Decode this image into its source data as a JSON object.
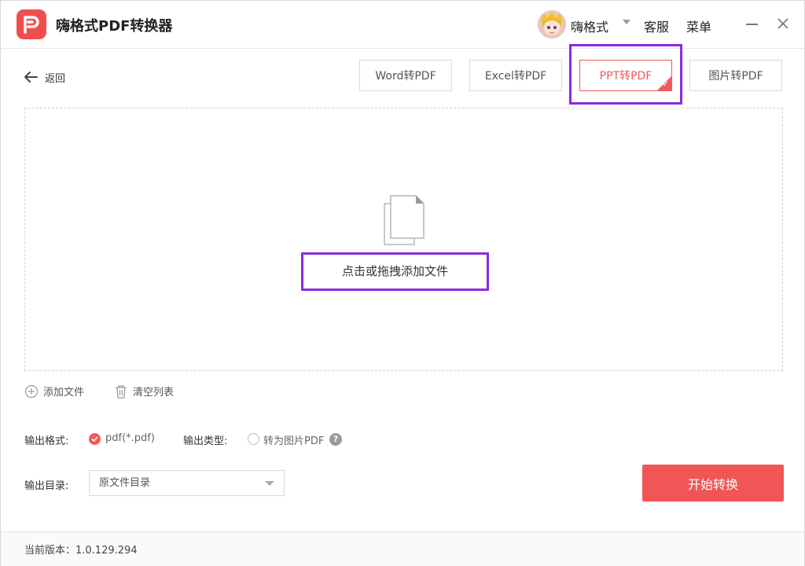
{
  "app": {
    "title": "嗨格式PDF转换器",
    "username": "嗨格式",
    "service_label": "客服",
    "menu_label": "菜单"
  },
  "nav": {
    "back_label": "返回"
  },
  "tabs": [
    {
      "label": "Word转PDF",
      "active": false
    },
    {
      "label": "Excel转PDF",
      "active": false
    },
    {
      "label": "PPT转PDF",
      "active": true
    },
    {
      "label": "图片转PDF",
      "active": false
    }
  ],
  "dropzone": {
    "text": "点击或拖拽添加文件",
    "icon": "file-stack-icon"
  },
  "file_actions": {
    "add_label": "添加文件",
    "clear_label": "清空列表"
  },
  "options": {
    "format_label": "输出格式:",
    "format_value": "pdf(*.pdf)",
    "type_label": "输出类型:",
    "type_option": "转为图片PDF",
    "dir_label": "输出目录:",
    "dir_value": "原文件目录"
  },
  "actions": {
    "start_label": "开始转换"
  },
  "footer": {
    "version": "当前版本：1.0.129.294"
  },
  "colors": {
    "accent": "#f05a5a",
    "highlight": "#8a2be2"
  }
}
